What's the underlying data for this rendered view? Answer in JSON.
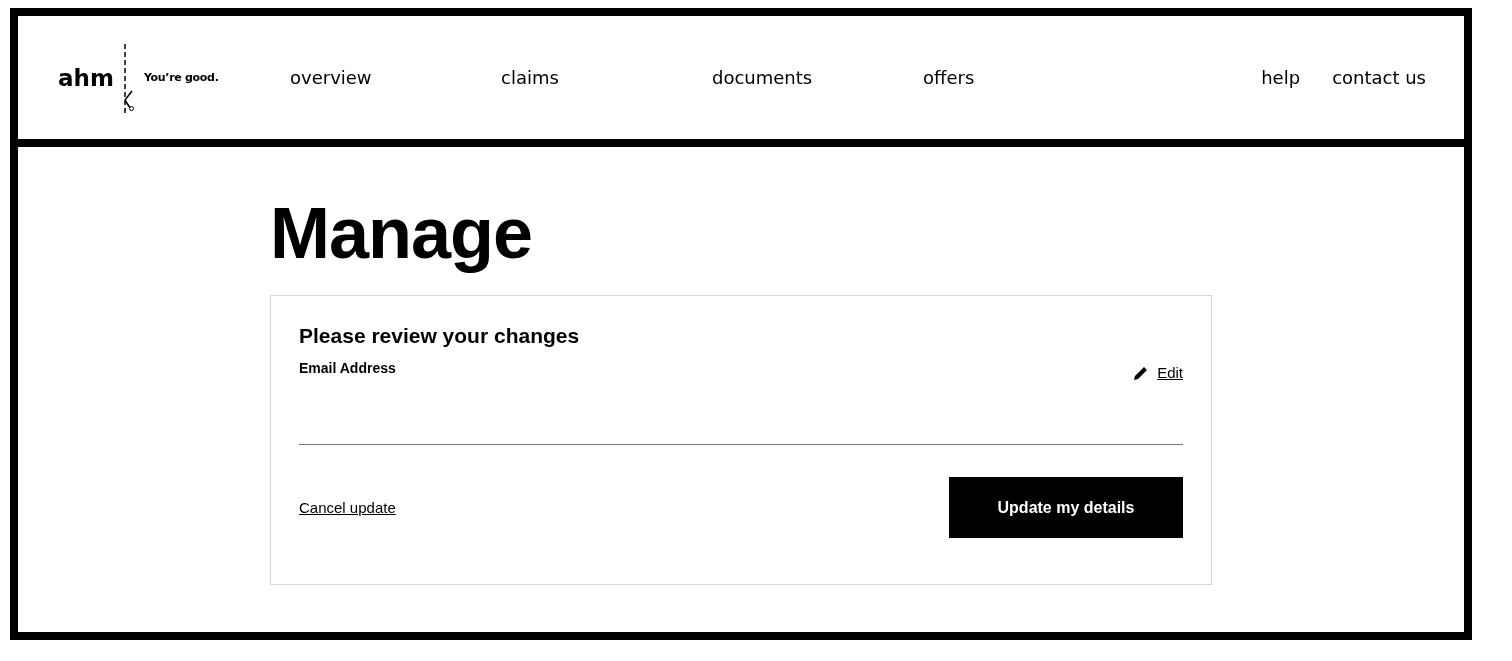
{
  "header": {
    "logo": "ahm",
    "tagline": "You’re good.",
    "nav": [
      {
        "label": "overview"
      },
      {
        "label": "claims"
      },
      {
        "label": "documents"
      },
      {
        "label": "offers"
      }
    ],
    "utility_links": [
      {
        "label": "help"
      },
      {
        "label": "contact us"
      }
    ]
  },
  "page_title": "Manage",
  "review_card": {
    "title": "Please review your changes",
    "field_label": "Email Address",
    "edit_link": "Edit",
    "cancel_link": "Cancel update",
    "submit_button": "Update my details"
  }
}
